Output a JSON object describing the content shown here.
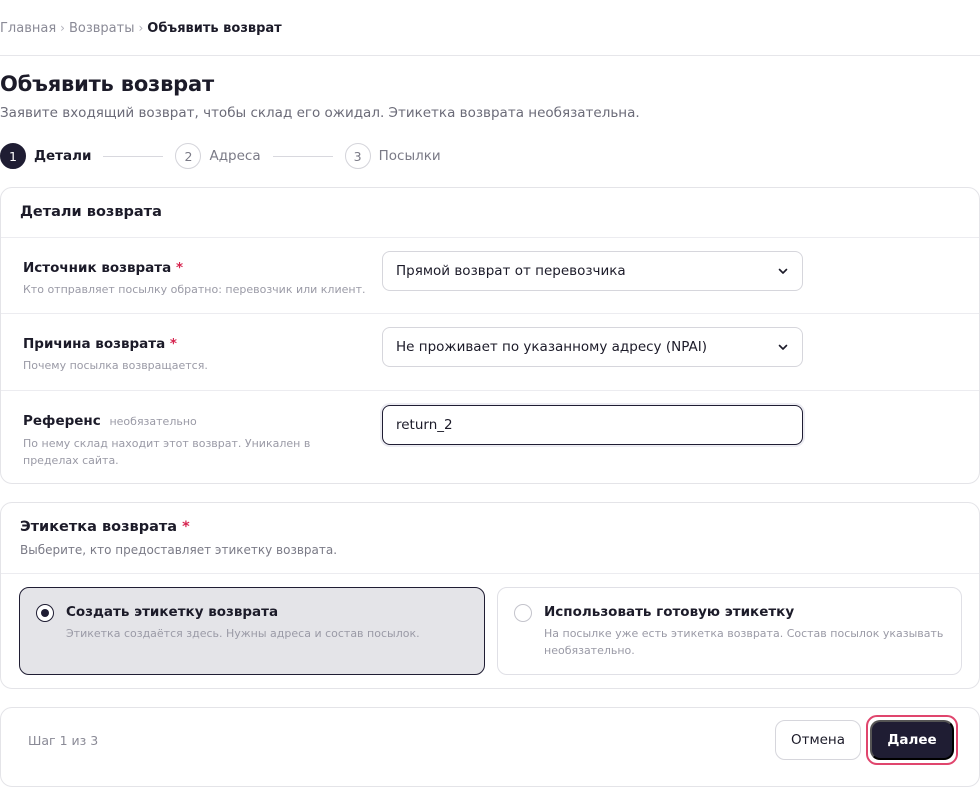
{
  "breadcrumb": {
    "items": [
      "Главная",
      "Возвраты"
    ],
    "current": "Объявить возврат",
    "separator": "›"
  },
  "page": {
    "title": "Объявить возврат",
    "subtitle": "Заявите входящий возврат, чтобы склад его ожидал. Этикетка возврата необязательна."
  },
  "stepper": {
    "steps": [
      {
        "number": "1",
        "label": "Детали",
        "active": true
      },
      {
        "number": "2",
        "label": "Адреса",
        "active": false
      },
      {
        "number": "3",
        "label": "Посылки",
        "active": false
      }
    ]
  },
  "details": {
    "title": "Детали возврата",
    "required_mark": "*",
    "source": {
      "label": "Источник возврата",
      "help": "Кто отправляет посылку обратно: перевозчик или клиент.",
      "value": "Прямой возврат от перевозчика"
    },
    "reason": {
      "label": "Причина возврата",
      "help": "Почему посылка возвращается.",
      "value": "Не проживает по указанному адресу (NPAI)"
    },
    "reference": {
      "label": "Референс",
      "optional": "необязательно",
      "help": "По нему склад находит этот возврат. Уникален в пределах сайта.",
      "value": "return_2"
    }
  },
  "label_section": {
    "title": "Этикетка возврата",
    "required_mark": "*",
    "subtitle": "Выберите, кто предоставляет этикетку возврата.",
    "options": [
      {
        "title": "Создать этикетку возврата",
        "description": "Этикетка создаётся здесь. Нужны адреса и состав посылок.",
        "selected": true
      },
      {
        "title": "Использовать готовую этикетку",
        "description": "На посылке уже есть этикетка возврата. Состав посылок указывать необязательно.",
        "selected": false
      }
    ]
  },
  "footer": {
    "step_counter": "Шаг 1 из 3",
    "cancel_label": "Отмена",
    "next_label": "Далее"
  },
  "colors": {
    "primary": "#1f1d33",
    "required": "#d6244f",
    "focus_ring": "#e0456d"
  },
  "icons": {
    "select_chevron": "chevron-down-icon",
    "radio": "radio-icon"
  }
}
